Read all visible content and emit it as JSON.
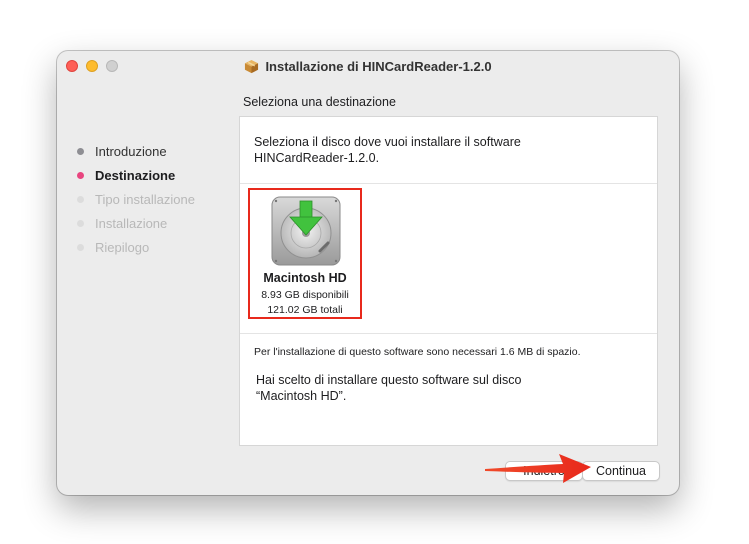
{
  "window": {
    "title": "Installazione di HINCardReader-1.2.0"
  },
  "page": {
    "heading": "Seleziona una destinazione"
  },
  "sidebar": {
    "steps": [
      {
        "label": "Introduzione",
        "state": "done"
      },
      {
        "label": "Destinazione",
        "state": "current"
      },
      {
        "label": "Tipo installazione",
        "state": "future"
      },
      {
        "label": "Installazione",
        "state": "future"
      },
      {
        "label": "Riepilogo",
        "state": "future"
      }
    ]
  },
  "panel": {
    "intro_line1": "Seleziona il disco dove vuoi installare il software",
    "intro_line2": "HINCardReader-1.2.0.",
    "disk": {
      "name": "Macintosh HD",
      "free": "8.93 GB disponibili",
      "total": "121.02 GB totali",
      "icon": "hard-drive-install-icon"
    },
    "space_note": "Per l'installazione di questo software sono necessari 1.6 MB di spazio.",
    "choice_line1": "Hai scelto di installare questo software sul disco",
    "choice_line2": "“Macintosh HD”."
  },
  "buttons": {
    "back_label": "Indietro",
    "continue_label": "Continua"
  },
  "colors": {
    "accent_step": "#e8457f",
    "highlight": "#e8291c"
  }
}
